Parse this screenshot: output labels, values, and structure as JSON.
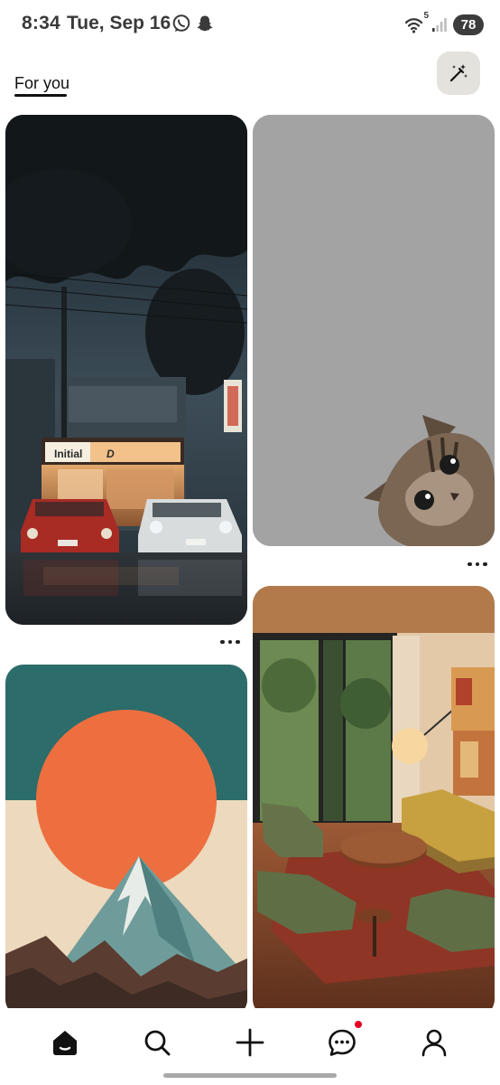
{
  "status_bar": {
    "time": "8:34",
    "date": "Tue, Sep 16",
    "app_icons": [
      "whatsapp-icon",
      "snapchat-icon"
    ],
    "network_label": "5",
    "battery": "78"
  },
  "header": {
    "tab_label": "For you",
    "action_icon": "magic-wand-icon"
  },
  "feed": {
    "pins": [
      {
        "id": "pin-1",
        "description": "rainy night street with Initial D shop and two parked cars",
        "shop_sign": "Initial",
        "shop_logo": "D"
      },
      {
        "id": "pin-2",
        "description": "cat peeking from bottom-right on grey background"
      },
      {
        "id": "pin-3",
        "description": "orange sun over snowy mountain poster"
      },
      {
        "id": "pin-4",
        "description": "mid-century living room with garden window"
      }
    ],
    "more_icon": "more-dots-icon"
  },
  "bottom_nav": {
    "items": [
      {
        "name": "home",
        "icon": "home-icon",
        "active": true
      },
      {
        "name": "search",
        "icon": "search-icon",
        "active": false
      },
      {
        "name": "create",
        "icon": "plus-icon",
        "active": false
      },
      {
        "name": "messages",
        "icon": "chat-icon",
        "active": false,
        "has_notification": true
      },
      {
        "name": "profile",
        "icon": "profile-icon",
        "active": false
      }
    ]
  },
  "colors": {
    "accent": "#e60023",
    "magic_button_bg": "#e4e2dc",
    "cat_background": "#a3a3a3"
  }
}
